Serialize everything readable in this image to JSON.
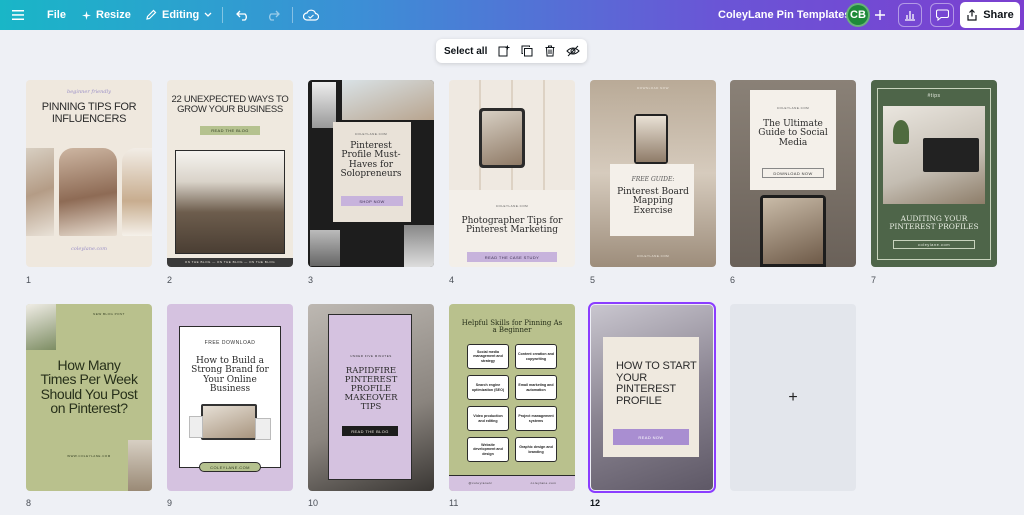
{
  "topbar": {
    "menu_icon": "hamburger-icon",
    "file_label": "File",
    "resize_label": "Resize",
    "editing_label": "Editing",
    "project_title": "ColeyLane Pin Templates",
    "avatar_initials": "CB",
    "share_label": "Share"
  },
  "selection_toolbar": {
    "select_all_label": "Select all",
    "icons": [
      "add-page-icon",
      "duplicate-icon",
      "trash-icon",
      "hide-icon"
    ]
  },
  "pages": [
    {
      "number": "1",
      "kicker": "beginner friendly",
      "title": "PINNING TIPS FOR INFLUENCERS",
      "footer": "coleylane.com"
    },
    {
      "number": "2",
      "title": "22 UNEXPECTED WAYS TO GROW YOUR BUSINESS",
      "button": "READ THE BLOG",
      "footer": "ON THE BLOG — ON THE BLOG — ON THE BLOG"
    },
    {
      "number": "3",
      "site": "COLEYLANE.COM",
      "title": "Pinterest Profile Must-Haves for Solopreneurs",
      "button": "SHOP NOW"
    },
    {
      "number": "4",
      "site": "COLEYLANE.COM",
      "title": "Photographer Tips for Pinterest Marketing",
      "button": "READ THE CASE STUDY"
    },
    {
      "number": "5",
      "top": "DOWNLOAD NOW",
      "kicker": "FREE GUIDE:",
      "title": "Pinterest Board Mapping Exercise",
      "footer": "COLEYLANE.COM"
    },
    {
      "number": "6",
      "site": "COLEYLANE.COM",
      "title": "The Ultimate Guide to Social Media",
      "button": "DOWNLOAD NOW"
    },
    {
      "number": "7",
      "tag": "#tips",
      "title": "AUDITING YOUR PINTEREST PROFILES",
      "footer": "coleylane.com"
    },
    {
      "number": "8",
      "kicker": "NEW BLOG POST",
      "title": "How Many Times Per Week Should You Post on Pinterest?",
      "footer": "WWW.COLEYLANE.COM"
    },
    {
      "number": "9",
      "kicker": "FREE DOWNLOAD",
      "title": "How to Build a Strong Brand for Your Online Business",
      "button": "COLEYLANE.COM"
    },
    {
      "number": "10",
      "kicker": "UNDER FIVE MINUTES",
      "title": "RAPIDFIRE PINTEREST PROFILE MAKEOVER TIPS",
      "button": "READ THE BLOG"
    },
    {
      "number": "11",
      "title": "Helpful Skills for Pinning As a Beginner",
      "skills": [
        "Social media management and strategy",
        "Content creation and copywriting",
        "Search engine optimization (SEO)",
        "Email marketing and automation",
        "Video production and editing",
        "Project management systems",
        "Website development and design",
        "Graphic design and branding"
      ],
      "footer_left": "@coleylanelc",
      "footer_right": "coleylane.com"
    },
    {
      "number": "12",
      "title": "HOW TO START YOUR PINTEREST PROFILE",
      "button": "READ NOW"
    }
  ],
  "add_page_icon": "plus-icon",
  "add_page_label": "+"
}
